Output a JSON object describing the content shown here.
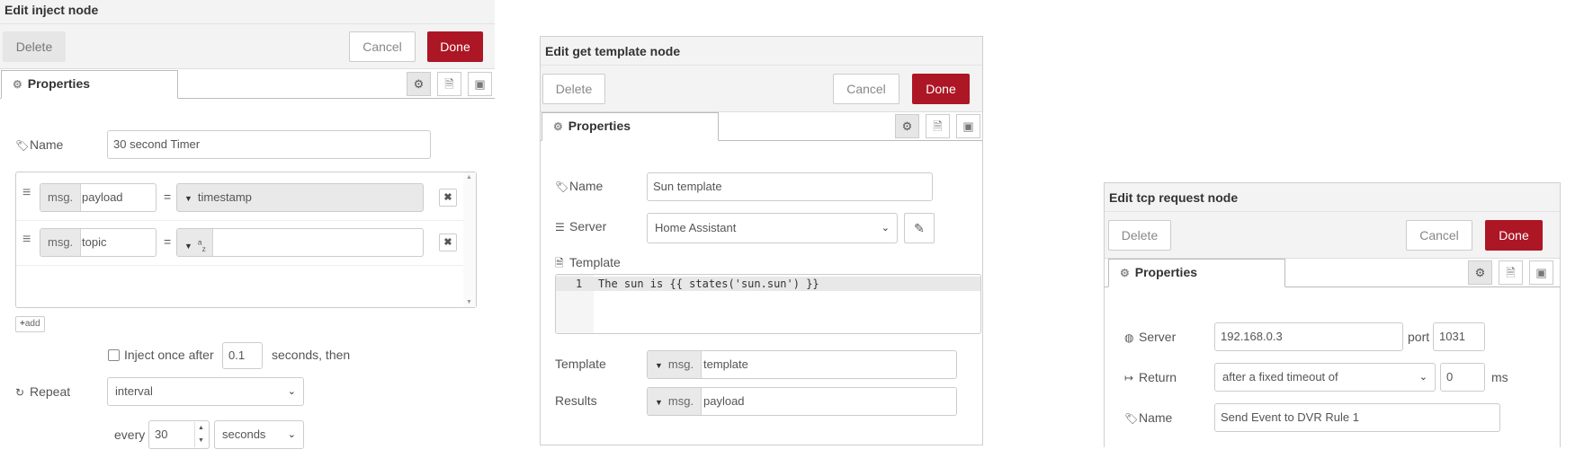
{
  "inject": {
    "title": "Edit inject node",
    "delete_label": "Delete",
    "cancel_label": "Cancel",
    "done_label": "Done",
    "tab_label": "Properties",
    "name_label": "Name",
    "name_value": "30 second Timer",
    "props": [
      {
        "prefix": "msg.",
        "key": "payload",
        "eq": "=",
        "value": "timestamp"
      },
      {
        "prefix": "msg.",
        "key": "topic",
        "eq": "=",
        "value": ""
      }
    ],
    "type_az_a": "a",
    "type_az_z": "z",
    "add_label": "add",
    "inject_once_label": "Inject once after",
    "inject_once_value": "0.1",
    "seconds_then_label": "seconds, then",
    "repeat_label": "Repeat",
    "repeat_value": "interval",
    "every_label": "every",
    "every_value": "30",
    "units_value": "seconds"
  },
  "template": {
    "title": "Edit get template node",
    "delete_label": "Delete",
    "cancel_label": "Cancel",
    "done_label": "Done",
    "tab_label": "Properties",
    "name_label": "Name",
    "name_value": "Sun template",
    "server_label": "Server",
    "server_value": "Home Assistant",
    "template_label": "Template",
    "line_number": "1",
    "code": "The sun is {{ states('sun.sun') }}",
    "template_prop_label": "Template",
    "template_prop_prefix": "msg.",
    "template_prop_value": "template",
    "results_label": "Results",
    "results_prefix": "msg.",
    "results_value": "payload"
  },
  "tcp": {
    "title": "Edit tcp request node",
    "delete_label": "Delete",
    "cancel_label": "Cancel",
    "done_label": "Done",
    "tab_label": "Properties",
    "server_label": "Server",
    "server_value": "192.168.0.3",
    "port_label": "port",
    "port_value": "1031",
    "return_label": "Return",
    "return_value": "after a fixed timeout of",
    "timeout_value": "0",
    "ms_label": "ms",
    "name_label": "Name",
    "name_value": "Send Event to DVR Rule 1"
  },
  "colors": {
    "primary": "#ad1625",
    "header_bg": "#f3f3f3"
  }
}
